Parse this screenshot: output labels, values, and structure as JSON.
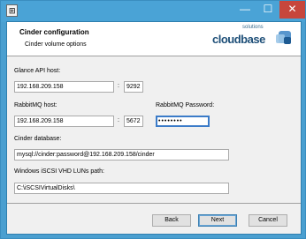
{
  "window": {
    "icon_glyph": "⊞",
    "minimize_glyph": "—",
    "maximize_glyph": "☐",
    "close_glyph": "✕",
    "accent": "#4aa3d6",
    "close_color": "#c7463c"
  },
  "banner": {
    "title": "Cinder configuration",
    "subtitle": "Cinder volume options",
    "logo_small": "solutions",
    "logo_big": "cloudbase"
  },
  "form": {
    "glance_label": "Glance API host:",
    "glance_host": "192.168.209.158",
    "glance_port": "9292",
    "rabbit_label": "RabbitMQ host:",
    "rabbit_host": "192.168.209.158",
    "rabbit_port": "5672",
    "rabbit_pw_label": "RabbitMQ Password:",
    "rabbit_pw_value": "••••••••",
    "db_label": "Cinder database:",
    "db_value": "mysql://cinder:password@192.168.209.158/cinder",
    "iscsi_label": "Windows iSCSI VHD LUNs path:",
    "iscsi_value": "C:\\iSCSIVirtualDisks\\",
    "colon": ":"
  },
  "buttons": {
    "back": "Back",
    "next": "Next",
    "cancel": "Cancel"
  }
}
